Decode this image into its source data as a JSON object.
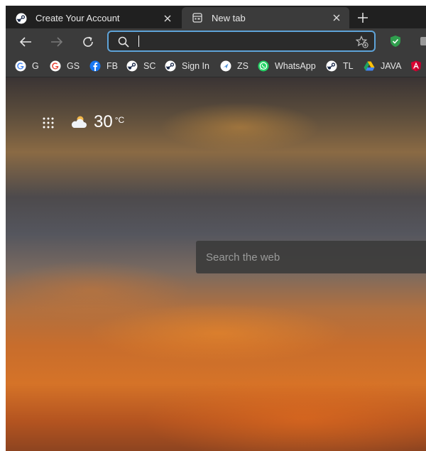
{
  "tabs": [
    {
      "title": "Create Your Account",
      "icon": "steam-icon",
      "active": false
    },
    {
      "title": "New tab",
      "icon": "newtab-page-icon",
      "active": true
    }
  ],
  "toolbar": {
    "address_value": "",
    "address_placeholder": ""
  },
  "bookmarks": [
    {
      "label": "G",
      "icon": "google-icon"
    },
    {
      "label": "GS",
      "icon": "google-icon"
    },
    {
      "label": "FB",
      "icon": "facebook-icon"
    },
    {
      "label": "SC",
      "icon": "steam-icon"
    },
    {
      "label": "Sign In",
      "icon": "steam-icon"
    },
    {
      "label": "ZS",
      "icon": "zs-icon"
    },
    {
      "label": "WhatsApp",
      "icon": "whatsapp-icon"
    },
    {
      "label": "TL",
      "icon": "steam-icon"
    },
    {
      "label": "JAVA",
      "icon": "google-drive-icon"
    }
  ],
  "weather": {
    "temperature": "30",
    "unit": "°C",
    "icon": "cloud-sun-icon"
  },
  "search": {
    "placeholder": "Search the web"
  },
  "colors": {
    "tab_active": "#3b3b3b",
    "tab_strip": "#202020",
    "address_focus": "#5ea3d8",
    "shield": "#2f9e4d"
  }
}
